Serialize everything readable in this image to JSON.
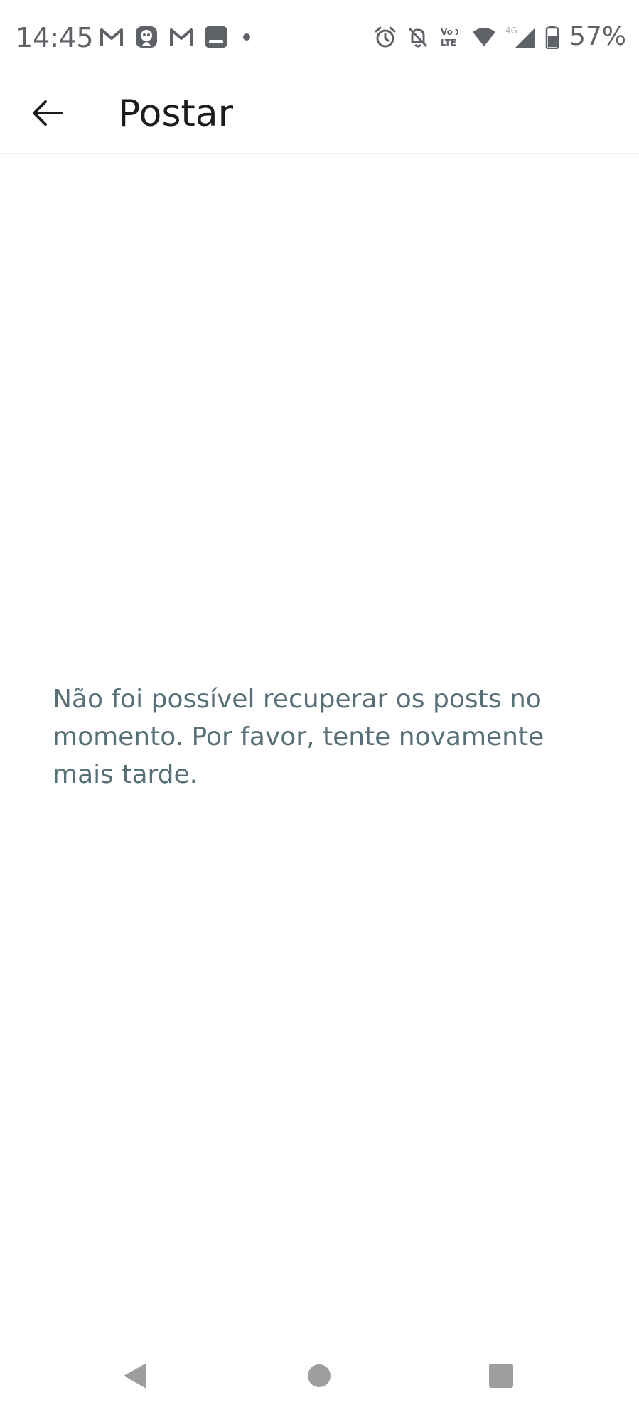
{
  "status_bar": {
    "time": "14:45",
    "battery_percent": "57%",
    "notification_icons": [
      "gmail-icon",
      "app-icon",
      "gmail-icon",
      "app-icon",
      "dot-icon"
    ],
    "system_icons": [
      "alarm-icon",
      "bell-off-icon",
      "volte-icon",
      "wifi-icon",
      "signal-4g-icon",
      "battery-icon"
    ]
  },
  "app_bar": {
    "title": "Postar"
  },
  "content": {
    "error_message": "Não foi possível recuperar os posts no momento. Por favor, tente novamente mais tarde."
  },
  "colors": {
    "title": "#1c1c1c",
    "message": "#576f76",
    "status_icons": "#5f6368",
    "nav_icons": "#9e9e9e",
    "divider": "#edeff1"
  }
}
